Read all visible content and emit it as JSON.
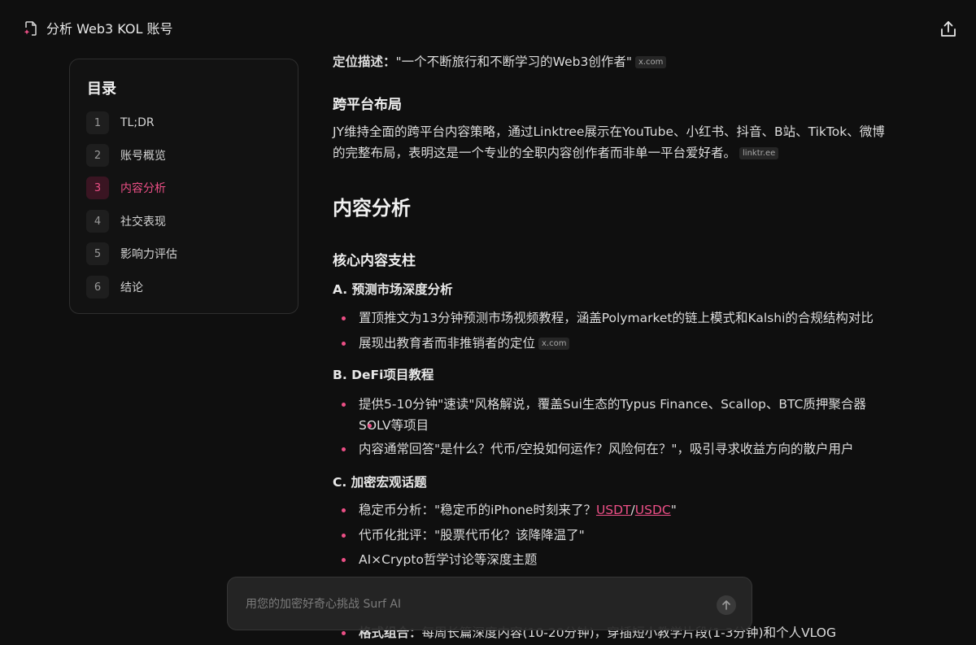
{
  "header": {
    "title": "分析 Web3 KOL 账号",
    "doc_icon": "document-sparkle-icon",
    "share_icon": "share-upload-icon"
  },
  "toc": {
    "heading": "目录",
    "items": [
      {
        "num": "1",
        "label": "TL;DR"
      },
      {
        "num": "2",
        "label": "账号概览"
      },
      {
        "num": "3",
        "label": "内容分析"
      },
      {
        "num": "4",
        "label": "社交表现"
      },
      {
        "num": "5",
        "label": "影响力评估"
      },
      {
        "num": "6",
        "label": "结论"
      }
    ],
    "active_index": 2
  },
  "content": {
    "positioning": {
      "label": "定位描述",
      "text": "\"一个不断旅行和不断学习的Web3创作者\"",
      "source": "x.com"
    },
    "cross_platform": {
      "heading": "跨平台布局",
      "line1": "JY维持全面的跨平台内容策略，通过Linktree展示在YouTube、小红书、抖音、B站、TikTok、微博",
      "line2": "的完整布局，表明这是一个专业的全职内容创作者而非单一平台爱好者。",
      "source": "linktr.ee"
    },
    "section_title": "内容分析",
    "pillars_heading": "核心内容支柱",
    "a": {
      "heading": "A. 预测市场深度分析",
      "b1": "置顶推文为13分钟预测市场视频教程，涵盖Polymarket的链上模式和Kalshi的合规结构对比",
      "b2": "展现出教育者而非推销者的定位",
      "b2_source": "x.com"
    },
    "b": {
      "heading": "B. DeFi项目教程",
      "b1_line1": "提供5-10分钟\"速读\"风格解说，覆盖Sui生态的Typus Finance、Scallop、BTC质押聚合器",
      "b1_line2": "SOLV等项目",
      "b2": "内容通常回答\"是什么？代币/空投如何运作？风险何在？\"，吸引寻求收益方向的散户用户"
    },
    "c": {
      "heading": "C. 加密宏观话题",
      "b1_prefix": "稳定币分析：\"稳定币的iPhone时刻来了？",
      "b1_link1": "USDT",
      "b1_sep": "/",
      "b1_link2": "USDC",
      "b1_suffix": "\"",
      "b2": "代币化批评：\"股票代币化？该降降温了\"",
      "b3": "AI×Crypto哲学讨论等深度主题"
    },
    "format": {
      "label": "格式组合",
      "text": "每周长篇深度内容(10-20分钟)，穿插短小教学片段(1-3分钟)和个人VLOG"
    }
  },
  "composer": {
    "placeholder": "用您的加密好奇心挑战 Surf AI",
    "send_icon": "arrow-up-icon"
  },
  "colors": {
    "background": "#0f0f0f",
    "accent": "#ec4f86",
    "panel_border": "#2e2e2e"
  }
}
